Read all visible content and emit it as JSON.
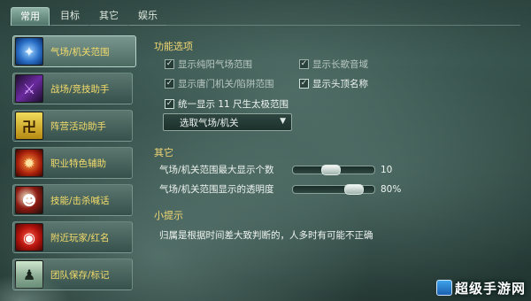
{
  "tabs": [
    {
      "label": "常用",
      "active": true
    },
    {
      "label": "目标",
      "active": false
    },
    {
      "label": "其它",
      "active": false
    },
    {
      "label": "娱乐",
      "active": false
    }
  ],
  "sidebar": {
    "items": [
      {
        "label": "气场/机关范围",
        "icon": "shield-swirl-icon",
        "glyph": "✦",
        "active": true
      },
      {
        "label": "战场/竞技助手",
        "icon": "crossed-swords-icon",
        "glyph": "⚔",
        "active": false
      },
      {
        "label": "阵营活动助手",
        "icon": "faction-emblem-icon",
        "glyph": "卍",
        "active": false
      },
      {
        "label": "职业特色辅助",
        "icon": "fire-dragon-icon",
        "glyph": "✹",
        "active": false
      },
      {
        "label": "技能/击杀喊话",
        "icon": "masked-face-icon",
        "glyph": "☻",
        "active": false
      },
      {
        "label": "附近玩家/红名",
        "icon": "red-target-icon",
        "glyph": "◉",
        "active": false
      },
      {
        "label": "团队保存/标记",
        "icon": "team-figure-icon",
        "glyph": "♟",
        "active": false
      }
    ]
  },
  "features": {
    "title": "功能选项",
    "checkboxes": [
      {
        "label": "显示纯阳气场范围",
        "checked": true
      },
      {
        "label": "显示长歌音域",
        "checked": true
      },
      {
        "label": "显示唐门机关/陷阱范围",
        "checked": true
      },
      {
        "label": "显示头顶名称",
        "checked": true
      },
      {
        "label": "统一显示 11 尺生太极范围",
        "checked": true
      }
    ],
    "dropdown": {
      "label": "选取气场/机关"
    }
  },
  "other": {
    "title": "其它",
    "sliders": [
      {
        "label": "气场/机关范围最大显示个数",
        "value": 10,
        "display": "10",
        "fraction": 0.45
      },
      {
        "label": "气场/机关范围显示的透明度",
        "value": 80,
        "display": "80%",
        "fraction": 0.8
      }
    ]
  },
  "tips": {
    "title": "小提示",
    "text": "归属是根据时间差大致判断的，人多时有可能不正确"
  },
  "watermark": "超级手游网",
  "colors": {
    "accent_text": "#f0d773",
    "sidebar_label": "#f4dc6a",
    "background": "#3b5751"
  }
}
